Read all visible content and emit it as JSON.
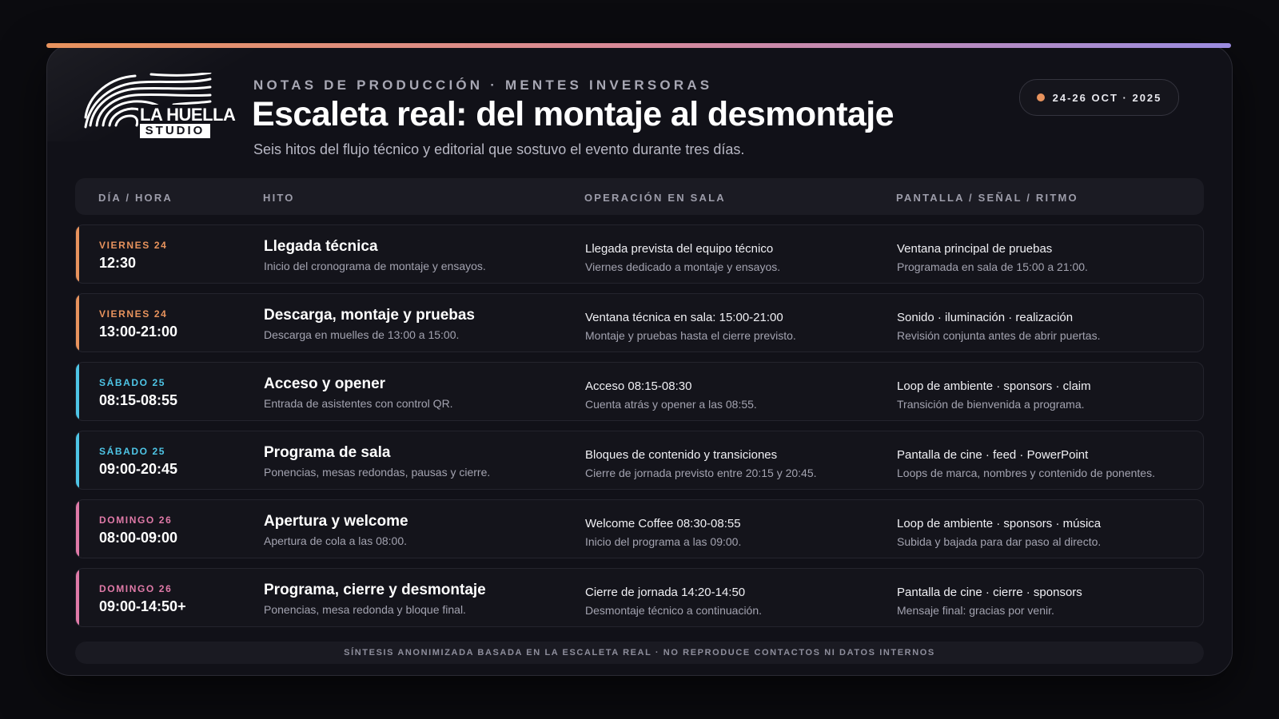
{
  "colors": {
    "orange": "#e8935d",
    "cyan": "#4ec5e6",
    "pink": "#e07aa8",
    "gradient_start": "#e8935d",
    "gradient_end": "#9b8ce0"
  },
  "header": {
    "logo": {
      "line1": "LA HUELLA",
      "line2": "STUDIO",
      "icon": "fingerprint-icon"
    },
    "eyebrow": "NOTAS DE PRODUCCIÓN · MENTES INVERSORAS",
    "title": "Escaleta real: del montaje al desmontaje",
    "subtitle": "Seis hitos del flujo técnico y editorial que sostuvo el evento durante tres días.",
    "date_badge": "24-26 OCT · 2025"
  },
  "table": {
    "columns": [
      "DÍA / HORA",
      "HITO",
      "OPERACIÓN EN SALA",
      "PANTALLA / SEÑAL / RITMO"
    ],
    "rows": [
      {
        "day": "VIERNES 24",
        "time": "12:30",
        "accent": "orange",
        "hito_title": "Llegada técnica",
        "hito_desc": "Inicio del cronograma de montaje y ensayos.",
        "op_title": "Llegada prevista del equipo técnico",
        "op_desc": "Viernes dedicado a montaje y ensayos.",
        "screen_title": "Ventana principal de pruebas",
        "screen_desc": "Programada en sala de 15:00 a 21:00."
      },
      {
        "day": "VIERNES 24",
        "time": "13:00-21:00",
        "accent": "orange",
        "hito_title": "Descarga, montaje y pruebas",
        "hito_desc": "Descarga en muelles de 13:00 a 15:00.",
        "op_title": "Ventana técnica en sala: 15:00-21:00",
        "op_desc": "Montaje y pruebas hasta el cierre previsto.",
        "screen_title": "Sonido · iluminación · realización",
        "screen_desc": "Revisión conjunta antes de abrir puertas."
      },
      {
        "day": "SÁBADO 25",
        "time": "08:15-08:55",
        "accent": "cyan",
        "hito_title": "Acceso y opener",
        "hito_desc": "Entrada de asistentes con control QR.",
        "op_title": "Acceso 08:15-08:30",
        "op_desc": "Cuenta atrás y opener a las 08:55.",
        "screen_title": "Loop de ambiente · sponsors · claim",
        "screen_desc": "Transición de bienvenida a programa."
      },
      {
        "day": "SÁBADO 25",
        "time": "09:00-20:45",
        "accent": "cyan",
        "hito_title": "Programa de sala",
        "hito_desc": "Ponencias, mesas redondas, pausas y cierre.",
        "op_title": "Bloques de contenido y transiciones",
        "op_desc": "Cierre de jornada previsto entre 20:15 y 20:45.",
        "screen_title": "Pantalla de cine · feed · PowerPoint",
        "screen_desc": "Loops de marca, nombres y contenido de ponentes."
      },
      {
        "day": "DOMINGO 26",
        "time": "08:00-09:00",
        "accent": "pink",
        "hito_title": "Apertura y welcome",
        "hito_desc": "Apertura de cola a las 08:00.",
        "op_title": "Welcome Coffee 08:30-08:55",
        "op_desc": "Inicio del programa a las 09:00.",
        "screen_title": "Loop de ambiente · sponsors · música",
        "screen_desc": "Subida y bajada para dar paso al directo."
      },
      {
        "day": "DOMINGO 26",
        "time": "09:00-14:50+",
        "accent": "pink",
        "hito_title": "Programa, cierre y desmontaje",
        "hito_desc": "Ponencias, mesa redonda y bloque final.",
        "op_title": "Cierre de jornada 14:20-14:50",
        "op_desc": "Desmontaje técnico a continuación.",
        "screen_title": "Pantalla de cine · cierre · sponsors",
        "screen_desc": "Mensaje final: gracias por venir."
      }
    ]
  },
  "footer": "SÍNTESIS ANONIMIZADA BASADA EN LA ESCALETA REAL · NO REPRODUCE CONTACTOS NI DATOS INTERNOS"
}
